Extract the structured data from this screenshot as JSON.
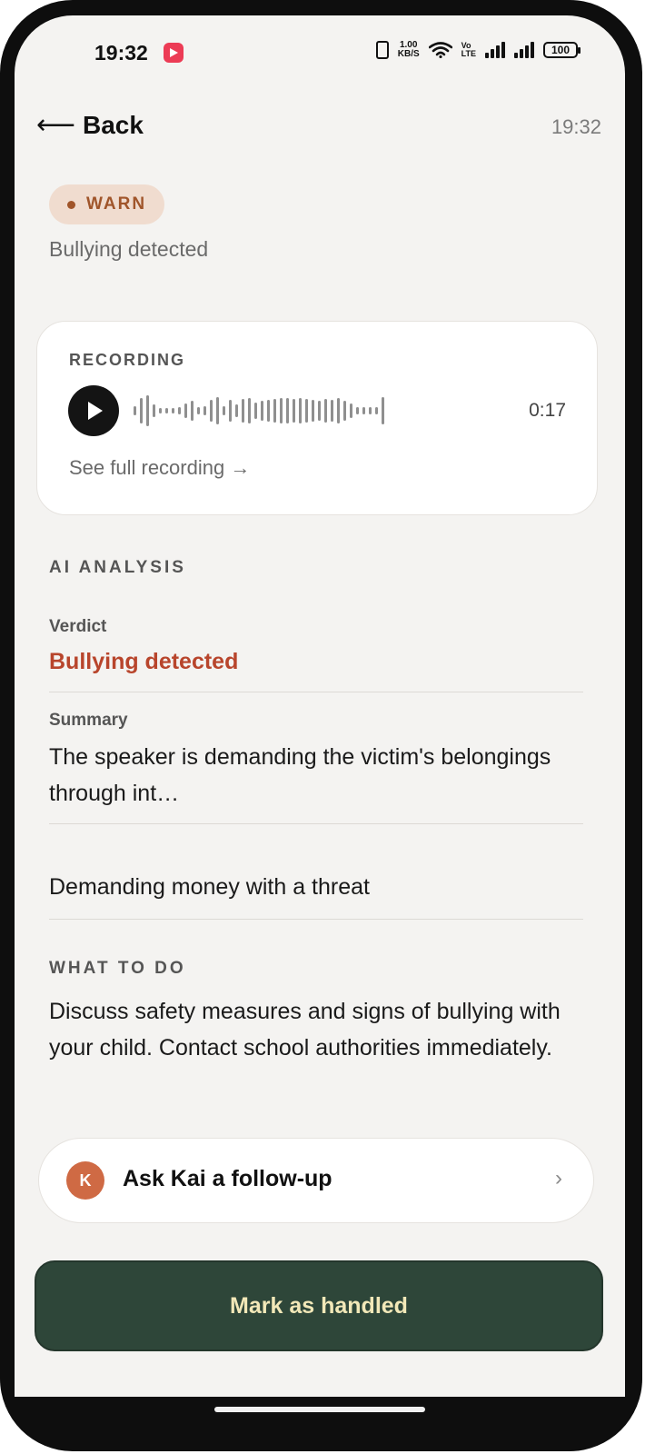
{
  "status_bar": {
    "time": "19:32",
    "net_speed_value": "1.00",
    "net_speed_unit": "KB/S",
    "volte_top": "Vo",
    "volte_bottom": "LTE",
    "battery": "100",
    "icons": [
      "youtube-notification-icon",
      "vibrate-icon",
      "wifi-icon",
      "signal-icon",
      "battery-icon"
    ]
  },
  "header": {
    "back_label": "Back",
    "back_icon": "arrow-left-icon",
    "time": "19:32"
  },
  "alert": {
    "badge": "WARN",
    "badge_color": "#a0552a",
    "subtitle": "Bullying detected"
  },
  "recording": {
    "title": "RECORDING",
    "duration": "0:17",
    "see_full_label": "See full recording →"
  },
  "analysis": {
    "section_title": "AI ANALYSIS",
    "verdict_label": "Verdict",
    "verdict_value": "Bullying detected",
    "verdict_color": "#b8452c",
    "summary_label": "Summary",
    "summary_text": "The speaker is demanding the victim's belongings through int…",
    "detail_text": "Demanding money with a threat"
  },
  "what_to_do": {
    "section_title": "WHAT TO DO",
    "text": "Discuss safety measures and signs of bullying with your child. Contact school authorities immediately."
  },
  "ask": {
    "avatar_letter": "K",
    "label": "Ask Kai a follow-up",
    "icon": "chevron-right-icon"
  },
  "action": {
    "mark_label": "Mark as handled",
    "button_color": "#2e4639"
  }
}
